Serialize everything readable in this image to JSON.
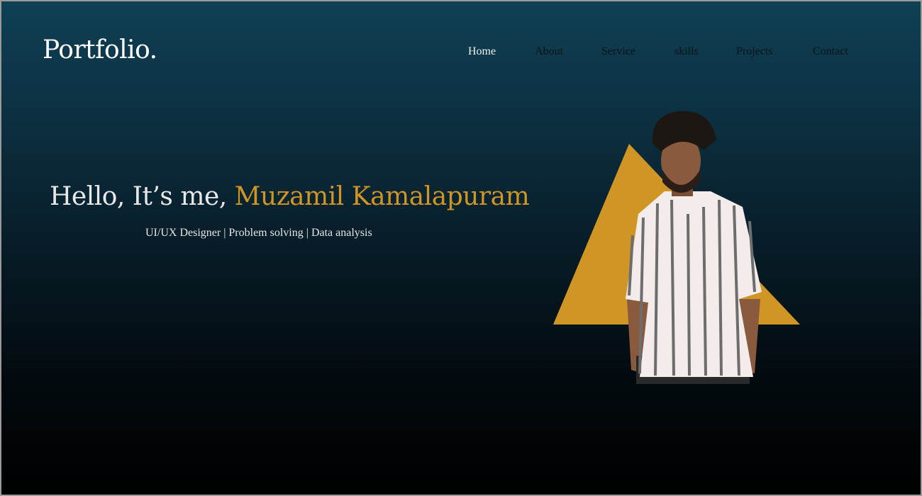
{
  "header": {
    "logo": "Portfolio."
  },
  "nav": {
    "items": [
      {
        "label": "Home",
        "active": true
      },
      {
        "label": "About"
      },
      {
        "label": "Service"
      },
      {
        "label": "skills"
      },
      {
        "label": "Projects"
      },
      {
        "label": "Contact"
      }
    ]
  },
  "hero": {
    "greeting": "Hello, It’s me, ",
    "name": "Muzamil Kamalapuram",
    "tagline": "UI/UX Designer | Problem solving | Data analysis"
  },
  "colors": {
    "accent": "#cf9625",
    "bg_top": "#0f4054",
    "bg_bottom": "#000000"
  }
}
